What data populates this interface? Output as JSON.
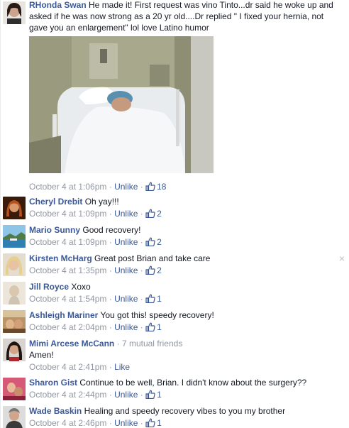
{
  "comments": [
    {
      "author": "RHonda Swan",
      "text": "He made it! First request was vino Tinto...dr said he woke up and asked if he was now strong as a 20 yr old....Dr replied \" I fixed your hernia, not gave you an enlargement\" lol love Latino humor",
      "time": "October 4 at 1:06pm",
      "action": "Unlike",
      "likes": "18",
      "avatar_color": "#6b4a3a"
    },
    {
      "author": "Cheryl Drebit",
      "text": "Oh yay!!!",
      "time": "October 4 at 1:09pm",
      "action": "Unlike",
      "likes": "2",
      "avatar_color": "#7a3b1c"
    },
    {
      "author": "Mario Sunny",
      "text": "Good recovery!",
      "time": "October 4 at 1:09pm",
      "action": "Unlike",
      "likes": "2",
      "avatar_color": "#5a8fb8"
    },
    {
      "author": "Kirsten McHarg",
      "text": "Great post Brian and take care",
      "time": "October 4 at 1:35pm",
      "action": "Unlike",
      "likes": "2",
      "avatar_color": "#c8b49a"
    },
    {
      "author": "Jill Royce",
      "text": "Xoxo",
      "time": "October 4 at 1:54pm",
      "action": "Unlike",
      "likes": "1",
      "avatar_color": "#d8d0c0"
    },
    {
      "author": "Ashleigh Mariner",
      "text": "You got this! speedy recovery!",
      "time": "October 4 at 2:04pm",
      "action": "Unlike",
      "likes": "1",
      "avatar_color": "#9c7a4a"
    },
    {
      "author": "Mimi Arcese McCann",
      "mutual": "· 7 mutual friends",
      "text": "Amen!",
      "time": "October 4 at 2:41pm",
      "action": "Like",
      "likes": "",
      "avatar_color": "#3a2a26"
    },
    {
      "author": "Sharon Gist",
      "text": "Continue to be well, Brian. I didn't know about the surgery??",
      "time": "October 4 at 2:44pm",
      "action": "Unlike",
      "likes": "1",
      "avatar_color": "#b23b54"
    },
    {
      "author": "Wade Baskin",
      "text": "Healing and speedy recovery vibes to you my brother",
      "time": "October 4 at 2:46pm",
      "action": "Unlike",
      "likes": "1",
      "avatar_color": "#6d6d6d"
    }
  ],
  "separator": " · ",
  "icons": {
    "like": "thumbs-up-icon",
    "close": "close-icon"
  },
  "close_glyph": "×",
  "colors": {
    "link": "#3b5998",
    "meta": "#9197a3",
    "text": "#141823"
  }
}
